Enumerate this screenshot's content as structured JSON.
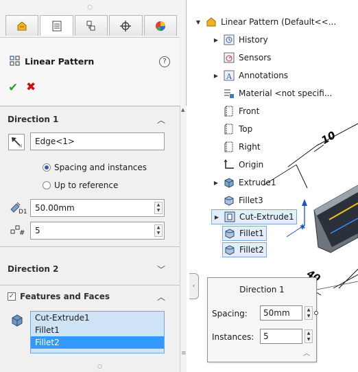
{
  "property_manager": {
    "tabs": [
      {
        "name": "feature-manager-tab",
        "active": false
      },
      {
        "name": "property-manager-tab",
        "active": true
      },
      {
        "name": "configuration-manager-tab",
        "active": false
      },
      {
        "name": "dimxpert-manager-tab",
        "active": false
      },
      {
        "name": "display-manager-tab",
        "active": false
      }
    ],
    "title": "Linear Pattern",
    "help_label": "?",
    "ok_glyph": "✔",
    "cancel_glyph": "✖",
    "direction1": {
      "label": "Direction 1",
      "edge_value": "Edge<1>",
      "radio_spacing": "Spacing and instances",
      "radio_reference": "Up to reference",
      "spacing_value": "50.00mm",
      "instances_value": "5",
      "spacing_selected": true
    },
    "direction2": {
      "label": "Direction 2"
    },
    "features_faces": {
      "label": "Features and Faces",
      "checked": true,
      "items": [
        "Cut-Extrude1",
        "Fillet1",
        "Fillet2"
      ],
      "selected_index": 2
    }
  },
  "feature_tree": {
    "root": "Linear Pattern  (Default<<...",
    "items": [
      {
        "label": "History",
        "expandable": true
      },
      {
        "label": "Sensors",
        "expandable": false
      },
      {
        "label": "Annotations",
        "expandable": true
      },
      {
        "label": "Material <not specifi...",
        "expandable": false
      },
      {
        "label": "Front",
        "expandable": false
      },
      {
        "label": "Top",
        "expandable": false
      },
      {
        "label": "Right",
        "expandable": false
      },
      {
        "label": "Origin",
        "expandable": false
      },
      {
        "label": "Extrude1",
        "expandable": true
      },
      {
        "label": "Fillet3",
        "expandable": false
      },
      {
        "label": "Cut-Extrude1",
        "expandable": true
      },
      {
        "label": "Fillet1",
        "expandable": false
      },
      {
        "label": "Fillet2",
        "expandable": false
      }
    ]
  },
  "popup": {
    "title": "Direction 1",
    "spacing_label": "Spacing:",
    "spacing_value": "50mm",
    "instances_label": "Instances:",
    "instances_value": "5"
  },
  "viewport": {
    "dim_10": "10",
    "dim_40": "40"
  },
  "colors": {
    "accent_blue": "#3399ff",
    "selection_bg": "#cfe3f7",
    "ok_green": "#2aa52a",
    "cancel_red": "#cc1111"
  }
}
